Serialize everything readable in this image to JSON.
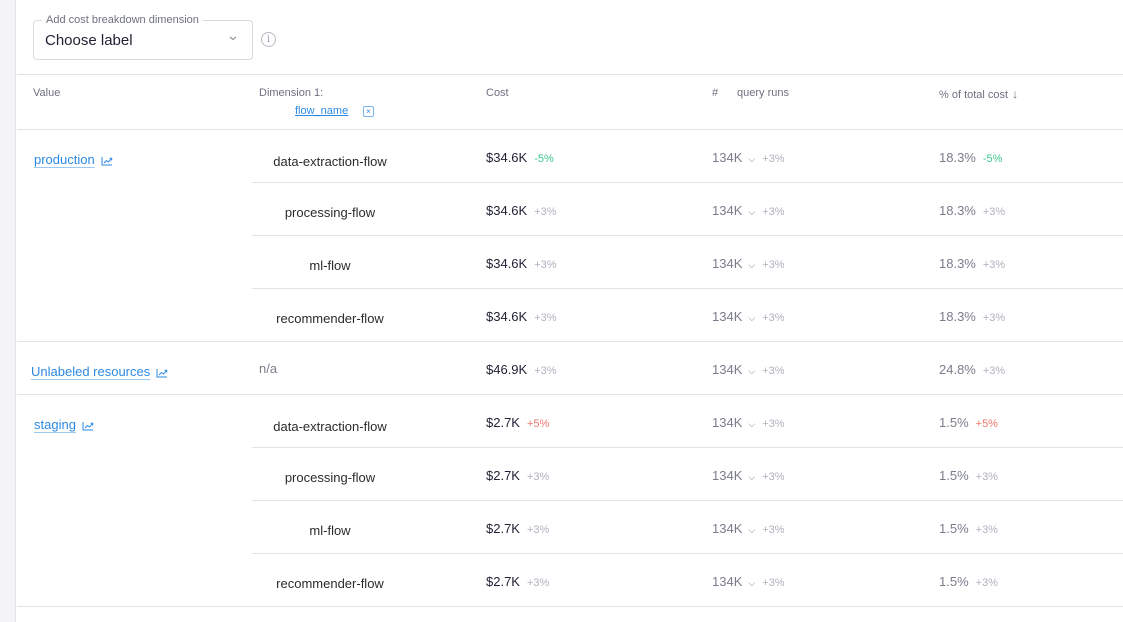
{
  "breakdown": {
    "legend": "Add cost breakdown dimension",
    "value": "Choose label",
    "info_icon": "info-icon"
  },
  "table": {
    "headers": {
      "value": "Value",
      "dimension": "Dimension 1:",
      "dimension_chip": "flow_name",
      "dimension_chip_remove": "×",
      "cost": "Cost",
      "runs_hash": "#",
      "runs": "query runs",
      "pct": "% of total cost",
      "pct_sort": "↓"
    },
    "groups": [
      {
        "label": "production",
        "rows": [
          {
            "flow": "data-extraction-flow",
            "cost": "$34.6K",
            "cost_delta": "-5%",
            "cost_delta_type": "good",
            "runs": "134K",
            "runs_delta": "+3%",
            "pct": "18.3%",
            "pct_delta": "-5%",
            "pct_delta_type": "good"
          },
          {
            "flow": "processing-flow",
            "cost": "$34.6K",
            "cost_delta": "+3%",
            "cost_delta_type": "neutral",
            "runs": "134K",
            "runs_delta": "+3%",
            "pct": "18.3%",
            "pct_delta": "+3%",
            "pct_delta_type": "neutral"
          },
          {
            "flow": "ml-flow",
            "cost": "$34.6K",
            "cost_delta": "+3%",
            "cost_delta_type": "neutral",
            "runs": "134K",
            "runs_delta": "+3%",
            "pct": "18.3%",
            "pct_delta": "+3%",
            "pct_delta_type": "neutral"
          },
          {
            "flow": "recommender-flow",
            "cost": "$34.6K",
            "cost_delta": "+3%",
            "cost_delta_type": "neutral",
            "runs": "134K",
            "runs_delta": "+3%",
            "pct": "18.3%",
            "pct_delta": "+3%",
            "pct_delta_type": "neutral"
          }
        ]
      },
      {
        "label": "Unlabeled resources",
        "rows": [
          {
            "flow": "n/a",
            "cost": "$46.9K",
            "cost_delta": "+3%",
            "cost_delta_type": "neutral",
            "runs": "134K",
            "runs_delta": "+3%",
            "pct": "24.8%",
            "pct_delta": "+3%",
            "pct_delta_type": "neutral"
          }
        ]
      },
      {
        "label": "staging",
        "rows": [
          {
            "flow": "data-extraction-flow",
            "cost": "$2.7K",
            "cost_delta": "+5%",
            "cost_delta_type": "bad",
            "runs": "134K",
            "runs_delta": "+3%",
            "pct": "1.5%",
            "pct_delta": "+5%",
            "pct_delta_type": "bad"
          },
          {
            "flow": "processing-flow",
            "cost": "$2.7K",
            "cost_delta": "+3%",
            "cost_delta_type": "neutral",
            "runs": "134K",
            "runs_delta": "+3%",
            "pct": "1.5%",
            "pct_delta": "+3%",
            "pct_delta_type": "neutral"
          },
          {
            "flow": "ml-flow",
            "cost": "$2.7K",
            "cost_delta": "+3%",
            "cost_delta_type": "neutral",
            "runs": "134K",
            "runs_delta": "+3%",
            "pct": "1.5%",
            "pct_delta": "+3%",
            "pct_delta_type": "neutral"
          },
          {
            "flow": "recommender-flow",
            "cost": "$2.7K",
            "cost_delta": "+3%",
            "cost_delta_type": "neutral",
            "runs": "134K",
            "runs_delta": "+3%",
            "pct": "1.5%",
            "pct_delta": "+3%",
            "pct_delta_type": "neutral"
          }
        ]
      }
    ]
  },
  "colors": {
    "link": "#2d8ae3",
    "delta_good": "#3cc98a",
    "delta_bad": "#f0786e",
    "delta_neutral": "#b0b1bd"
  }
}
